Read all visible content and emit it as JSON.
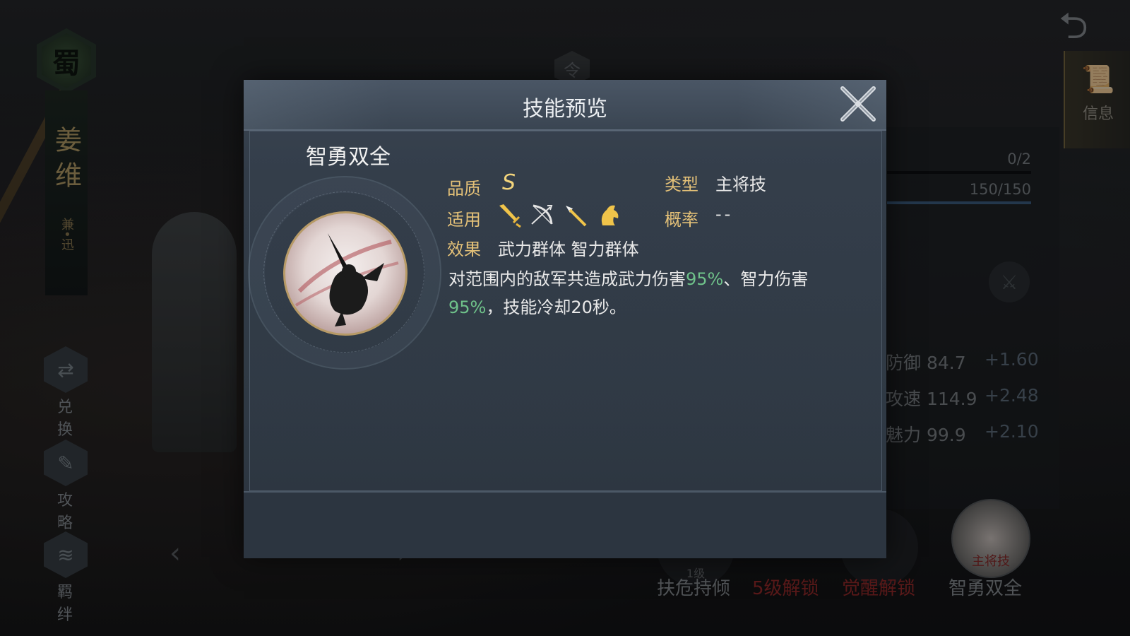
{
  "background": {
    "faction": "蜀",
    "hero_name": "姜维",
    "hero_tag": "兼•迅",
    "side_menu": [
      {
        "label": "兑换",
        "icon": "exchange-icon"
      },
      {
        "label": "攻略",
        "icon": "guide-scroll-icon"
      },
      {
        "label": "羁绊",
        "icon": "bond-icon"
      }
    ],
    "top_token": "令",
    "info_tab_label": "信息",
    "counts": [
      "0/2",
      "150/150"
    ],
    "attributes": [
      {
        "name": "防御",
        "value": "84.7",
        "bonus": "+1.60"
      },
      {
        "name": "攻速",
        "value": "114.9",
        "bonus": "+2.48"
      },
      {
        "name": "魅力",
        "value": "99.9",
        "bonus": "+2.10"
      }
    ],
    "skill_slots": [
      {
        "label": "扶危持倾",
        "sub": "1级",
        "state": "normal"
      },
      {
        "label": "5级解锁",
        "state": "locked"
      },
      {
        "label": "觉醒解锁",
        "state": "locked"
      },
      {
        "label": "智勇双全",
        "sub": "主将技",
        "state": "main"
      }
    ],
    "colors": {
      "locked": "#9a2c2c",
      "gold": "#e4c178",
      "highlight": "#6fc28a"
    }
  },
  "modal": {
    "title": "技能预览",
    "skill_name": "智勇双全",
    "quality_label": "品质",
    "quality_value": "S",
    "type_label": "类型",
    "type_value": "主将技",
    "apply_label": "适用",
    "apply_icons": [
      "sword-icon",
      "bow-icon",
      "spear-icon",
      "horse-icon"
    ],
    "chance_label": "概率",
    "chance_value": "--",
    "effect_label": "效果",
    "effect_value": "武力群体 智力群体",
    "description": {
      "part1": "对范围内的敌军共造成武力伤害",
      "pct1": "95%",
      "part2": "、智力伤害",
      "pct2": "95%",
      "part3": "，技能冷却20秒。"
    }
  }
}
